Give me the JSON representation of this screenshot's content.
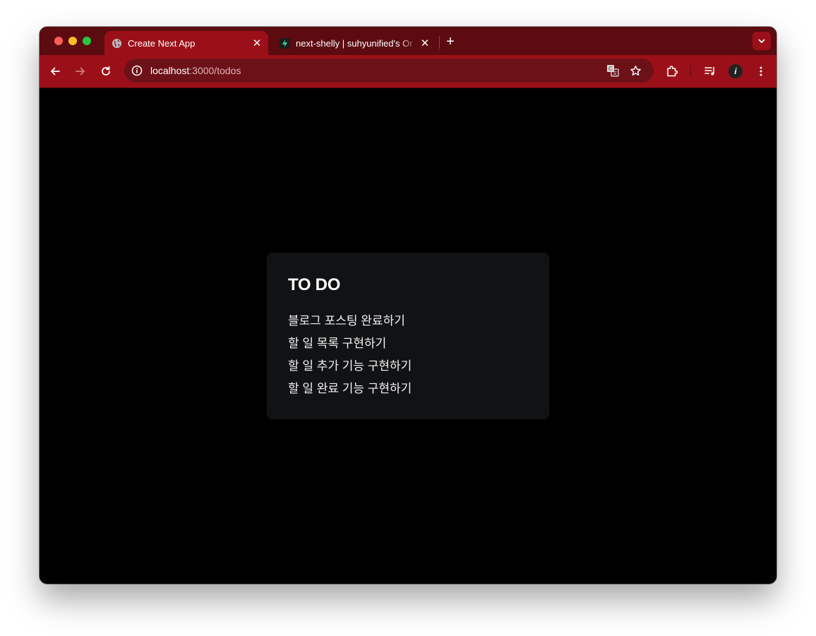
{
  "browser": {
    "tabs": [
      {
        "title": "Create Next App",
        "favicon": "globe-icon",
        "active": true
      },
      {
        "title": "next-shelly | suhyunified's Or",
        "favicon": "supabase-icon",
        "active": false
      }
    ],
    "address": {
      "host": "localhost",
      "path": ":3000/todos"
    },
    "colors": {
      "tabstrip": "#5c0b10",
      "toolbar": "#9b1018",
      "omnibox": "#6d1118"
    },
    "avatar_initial": "i"
  },
  "page": {
    "title": "TO DO",
    "todos": [
      "블로그 포스팅 완료하기",
      "할 일 목록 구현하기",
      "할 일 추가 기능 구현하기",
      "할 일 완료 기능 구현하기"
    ]
  }
}
